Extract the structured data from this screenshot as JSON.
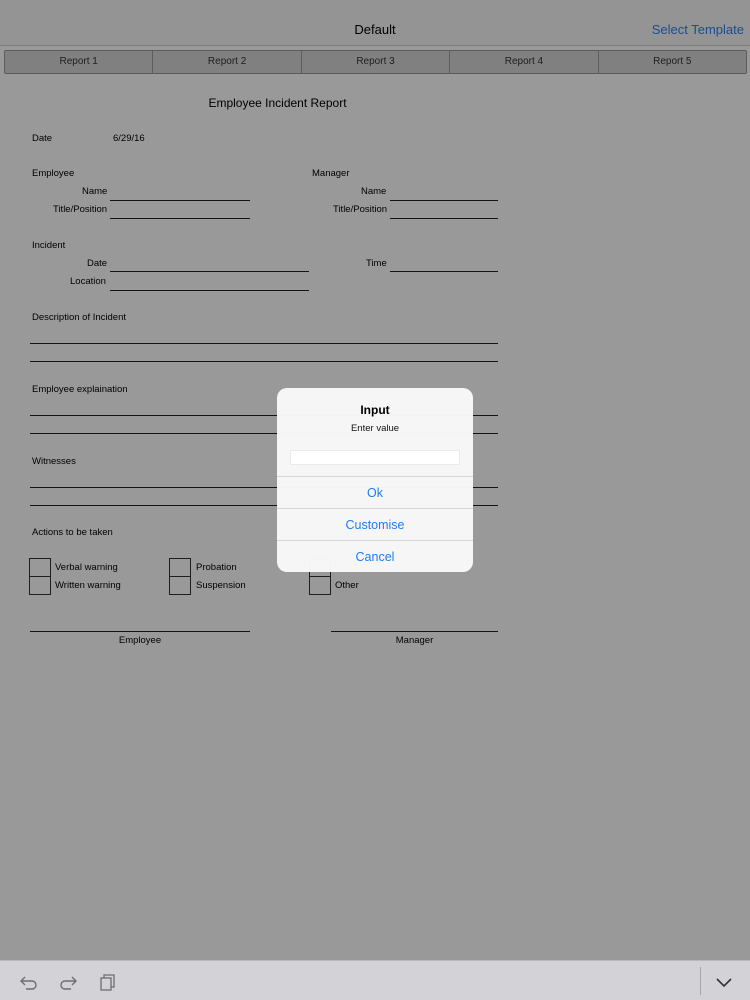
{
  "nav": {
    "title": "Default",
    "select_template": "Select Template"
  },
  "tabs": [
    "Report 1",
    "Report 2",
    "Report 3",
    "Report 4",
    "Report 5"
  ],
  "form": {
    "title": "Employee Incident Report",
    "date_label": "Date",
    "date_value": "6/29/16",
    "employee_label": "Employee",
    "manager_label": "Manager",
    "name_label": "Name",
    "title_label": "Title/Position",
    "incident_label": "Incident",
    "incident_date_label": "Date",
    "incident_location_label": "Location",
    "time_label": "Time",
    "description_label": "Description of Incident",
    "explanation_label": "Employee explaination",
    "witnesses_label": "Witnesses",
    "actions_label": "Actions to be taken",
    "actions": {
      "verbal_warning": "Verbal warning",
      "written_warning": "Written warning",
      "probation": "Probation",
      "suspension": "Suspension",
      "other": "Other"
    },
    "sign_employee": "Employee",
    "sign_manager": "Manager"
  },
  "alert": {
    "title": "Input",
    "message": "Enter value",
    "input_value": "",
    "ok": "Ok",
    "customise": "Customise",
    "cancel": "Cancel"
  },
  "toolbar": {
    "icons": [
      "undo-icon",
      "redo-icon",
      "copy-icon",
      "chevron-down-icon"
    ]
  },
  "colors": {
    "accent": "#1d7ef5",
    "overlay": "rgba(0,0,0,0.40)"
  }
}
